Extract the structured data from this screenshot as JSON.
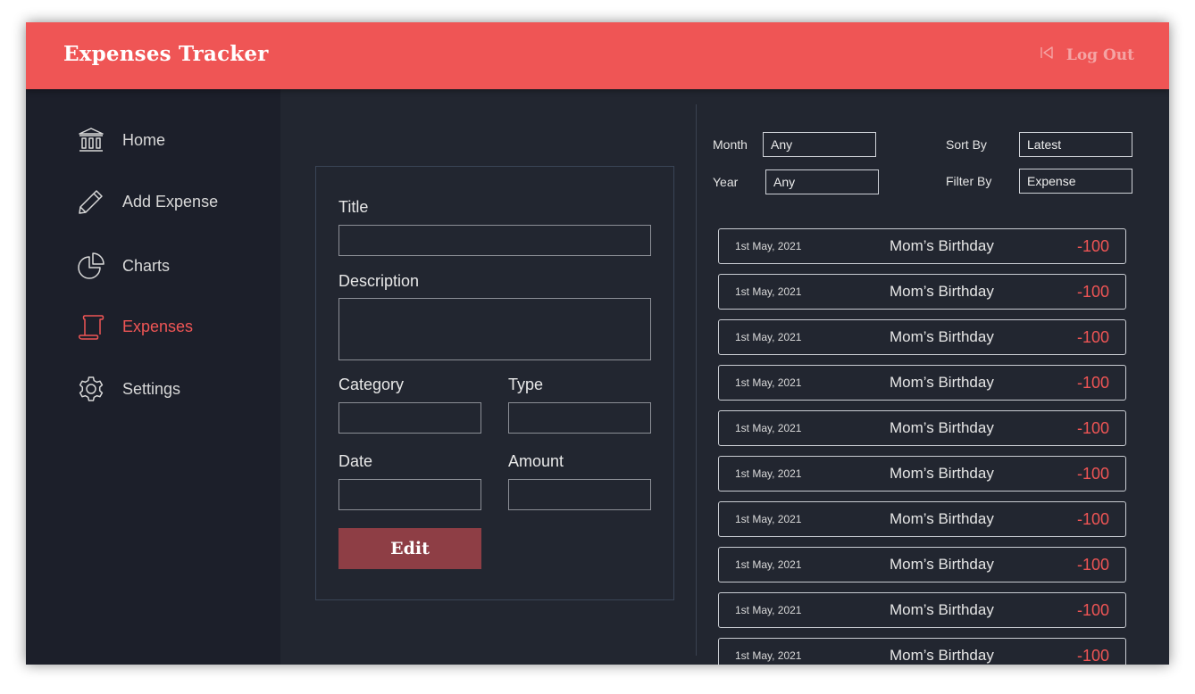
{
  "header": {
    "title": "Expenses Tracker",
    "logout_label": "Log Out",
    "logout_icon": "logout-arrow-icon",
    "accent": "#ef5555"
  },
  "sidebar": {
    "items": [
      {
        "label": "Home",
        "icon": "bank-icon",
        "active": false
      },
      {
        "label": "Add Expense",
        "icon": "pencil-icon",
        "active": false
      },
      {
        "label": "Charts",
        "icon": "pie-chart-icon",
        "active": false
      },
      {
        "label": "Expenses",
        "icon": "scroll-icon",
        "active": true
      },
      {
        "label": "Settings",
        "icon": "gear-icon",
        "active": false
      }
    ]
  },
  "form": {
    "title_label": "Title",
    "title_value": "",
    "description_label": "Description",
    "description_value": "",
    "category_label": "Category",
    "category_value": "",
    "type_label": "Type",
    "type_value": "",
    "date_label": "Date",
    "date_value": "",
    "amount_label": "Amount",
    "amount_value": "",
    "edit_label": "Edit"
  },
  "filters": {
    "month_label": "Month",
    "month_value": "Any",
    "year_label": "Year",
    "year_value": "Any",
    "sort_label": "Sort By",
    "sort_value": "Latest",
    "filter_label": "Filter By",
    "filter_value": "Expense"
  },
  "expenses": [
    {
      "date": "1st May, 2021",
      "title": "Mom’s Birthday",
      "amount": "-100"
    },
    {
      "date": "1st May, 2021",
      "title": "Mom’s Birthday",
      "amount": "-100"
    },
    {
      "date": "1st May, 2021",
      "title": "Mom’s Birthday",
      "amount": "-100"
    },
    {
      "date": "1st May, 2021",
      "title": "Mom’s Birthday",
      "amount": "-100"
    },
    {
      "date": "1st May, 2021",
      "title": "Mom’s Birthday",
      "amount": "-100"
    },
    {
      "date": "1st May, 2021",
      "title": "Mom’s Birthday",
      "amount": "-100"
    },
    {
      "date": "1st May, 2021",
      "title": "Mom’s Birthday",
      "amount": "-100"
    },
    {
      "date": "1st May, 2021",
      "title": "Mom’s Birthday",
      "amount": "-100"
    },
    {
      "date": "1st May, 2021",
      "title": "Mom’s Birthday",
      "amount": "-100"
    },
    {
      "date": "1st May, 2021",
      "title": "Mom’s Birthday",
      "amount": "-100"
    }
  ]
}
